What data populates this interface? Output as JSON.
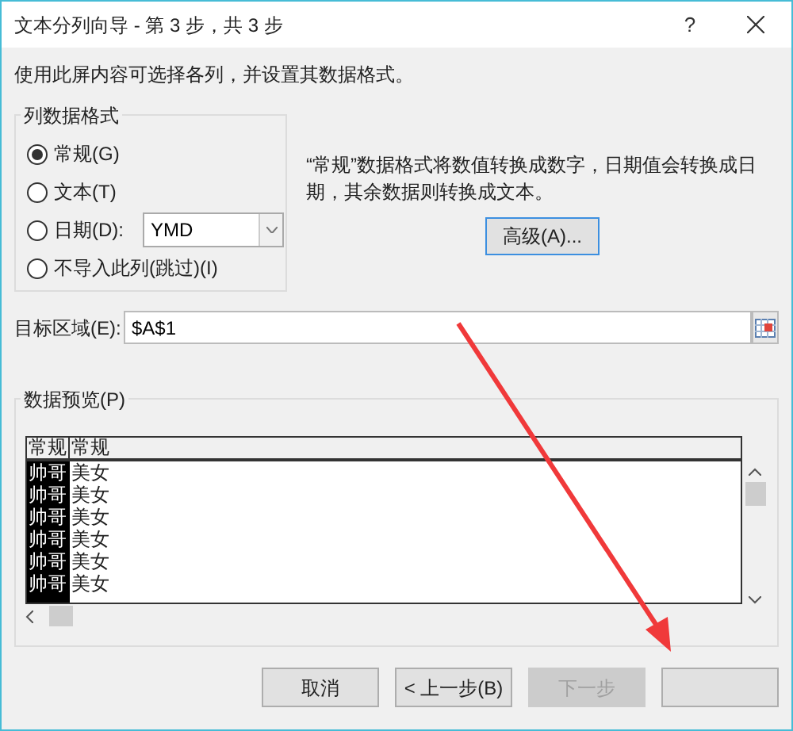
{
  "window": {
    "title": "文本分列向导 - 第 3 步，共 3 步",
    "help": "?"
  },
  "instruction": "使用此屏内容可选择各列，并设置其数据格式。",
  "format_group": {
    "title": "列数据格式",
    "date_format": "YMD",
    "options": [
      {
        "label": "常规(G)",
        "selected": true,
        "kind": "plain"
      },
      {
        "label": "文本(T)",
        "selected": false,
        "kind": "plain"
      },
      {
        "label": "日期(D):",
        "selected": false,
        "kind": "date"
      },
      {
        "label": "不导入此列(跳过)(I)",
        "selected": false,
        "kind": "plain"
      }
    ]
  },
  "description": "“常规”数据格式将数值转换成数字，日期值会转换成日期，其余数据则转换成文本。",
  "advanced_button": "高级(A)...",
  "destination": {
    "label": "目标区域(E):",
    "value": "$A$1"
  },
  "preview": {
    "title": "数据预览(P)",
    "columns": [
      {
        "header": "常规",
        "selected": true
      },
      {
        "header": "常规",
        "selected": false
      }
    ],
    "rows": [
      [
        "帅哥",
        "美女"
      ],
      [
        "帅哥",
        "美女"
      ],
      [
        "帅哥",
        "美女"
      ],
      [
        "帅哥",
        "美女"
      ],
      [
        "帅哥",
        "美女"
      ],
      [
        "帅哥",
        "美女"
      ]
    ]
  },
  "buttons": [
    {
      "label": "取消",
      "disabled": false
    },
    {
      "label": "< 上一步(B)",
      "disabled": false
    },
    {
      "label": "下一步",
      "disabled": true
    },
    {
      "disabled": false
    }
  ]
}
